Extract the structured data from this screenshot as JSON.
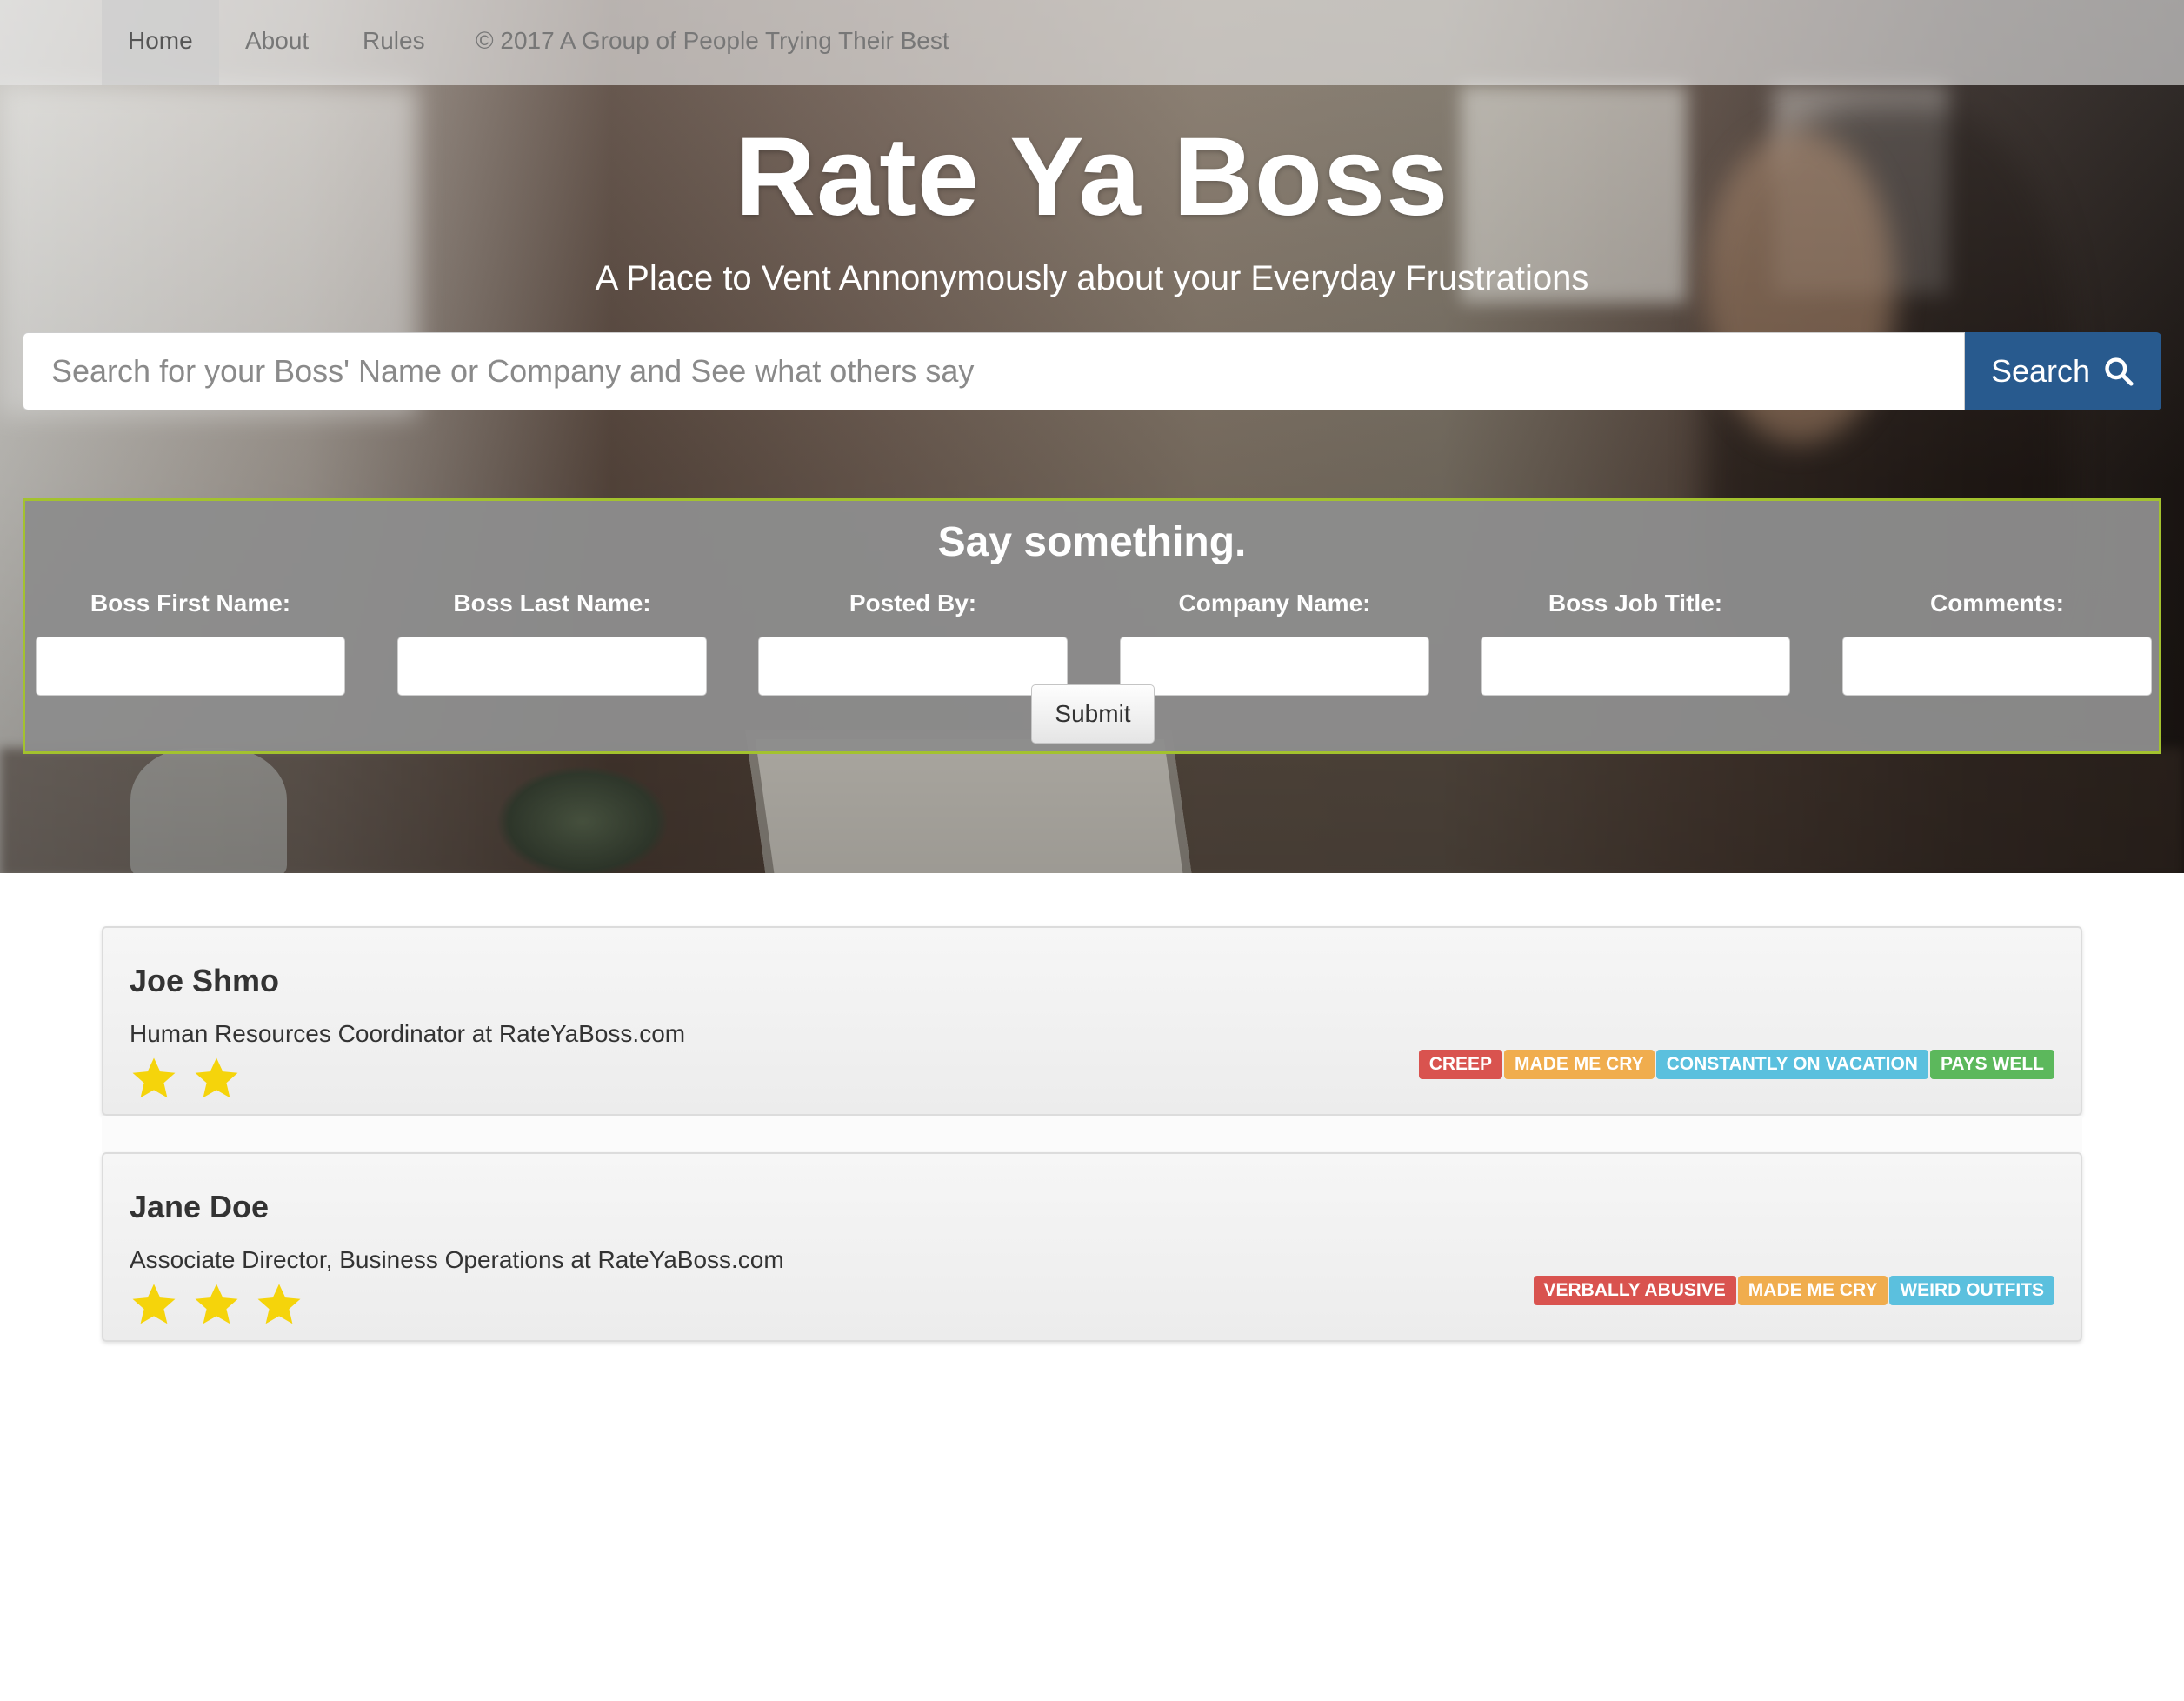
{
  "nav": {
    "items": [
      {
        "label": "Home",
        "active": true
      },
      {
        "label": "About",
        "active": false
      },
      {
        "label": "Rules",
        "active": false
      }
    ],
    "copyright": "© 2017 A Group of People Trying Their Best"
  },
  "hero": {
    "title": "Rate Ya Boss",
    "subtitle": "A Place to Vent Annonymously about your Everyday Frustrations"
  },
  "search": {
    "placeholder": "Search for your Boss' Name or Company and See what others say",
    "value": "",
    "button_label": "Search",
    "button_icon": "search-icon"
  },
  "form": {
    "title": "Say something.",
    "fields": [
      {
        "label": "Boss First Name:",
        "value": ""
      },
      {
        "label": "Boss Last Name:",
        "value": ""
      },
      {
        "label": "Posted By:",
        "value": ""
      },
      {
        "label": "Company Name:",
        "value": ""
      },
      {
        "label": "Boss Job Title:",
        "value": ""
      },
      {
        "label": "Comments:",
        "value": ""
      }
    ],
    "submit_label": "Submit",
    "border_color": "#a3c22e"
  },
  "reviews": [
    {
      "name": "Joe Shmo",
      "subtitle": "Human Resources Coordinator at RateYaBoss.com",
      "stars": 2,
      "tags": [
        "CREEP",
        "MADE ME CRY",
        "CONSTANTLY ON VACATION",
        "PAYS WELL"
      ]
    },
    {
      "name": "Jane Doe",
      "subtitle": "Associate Director, Business Operations at RateYaBoss.com",
      "stars": 3,
      "tags": [
        "VERBALLY ABUSIVE",
        "MADE ME CRY",
        "WEIRD OUTFITS"
      ]
    }
  ],
  "colors": {
    "search_button": "#285a8e",
    "star": "#f5d40b",
    "tag_red": "#d9534f",
    "tag_orange": "#f0ad4e",
    "tag_blue": "#5bc0de",
    "tag_green": "#5cb85c"
  }
}
